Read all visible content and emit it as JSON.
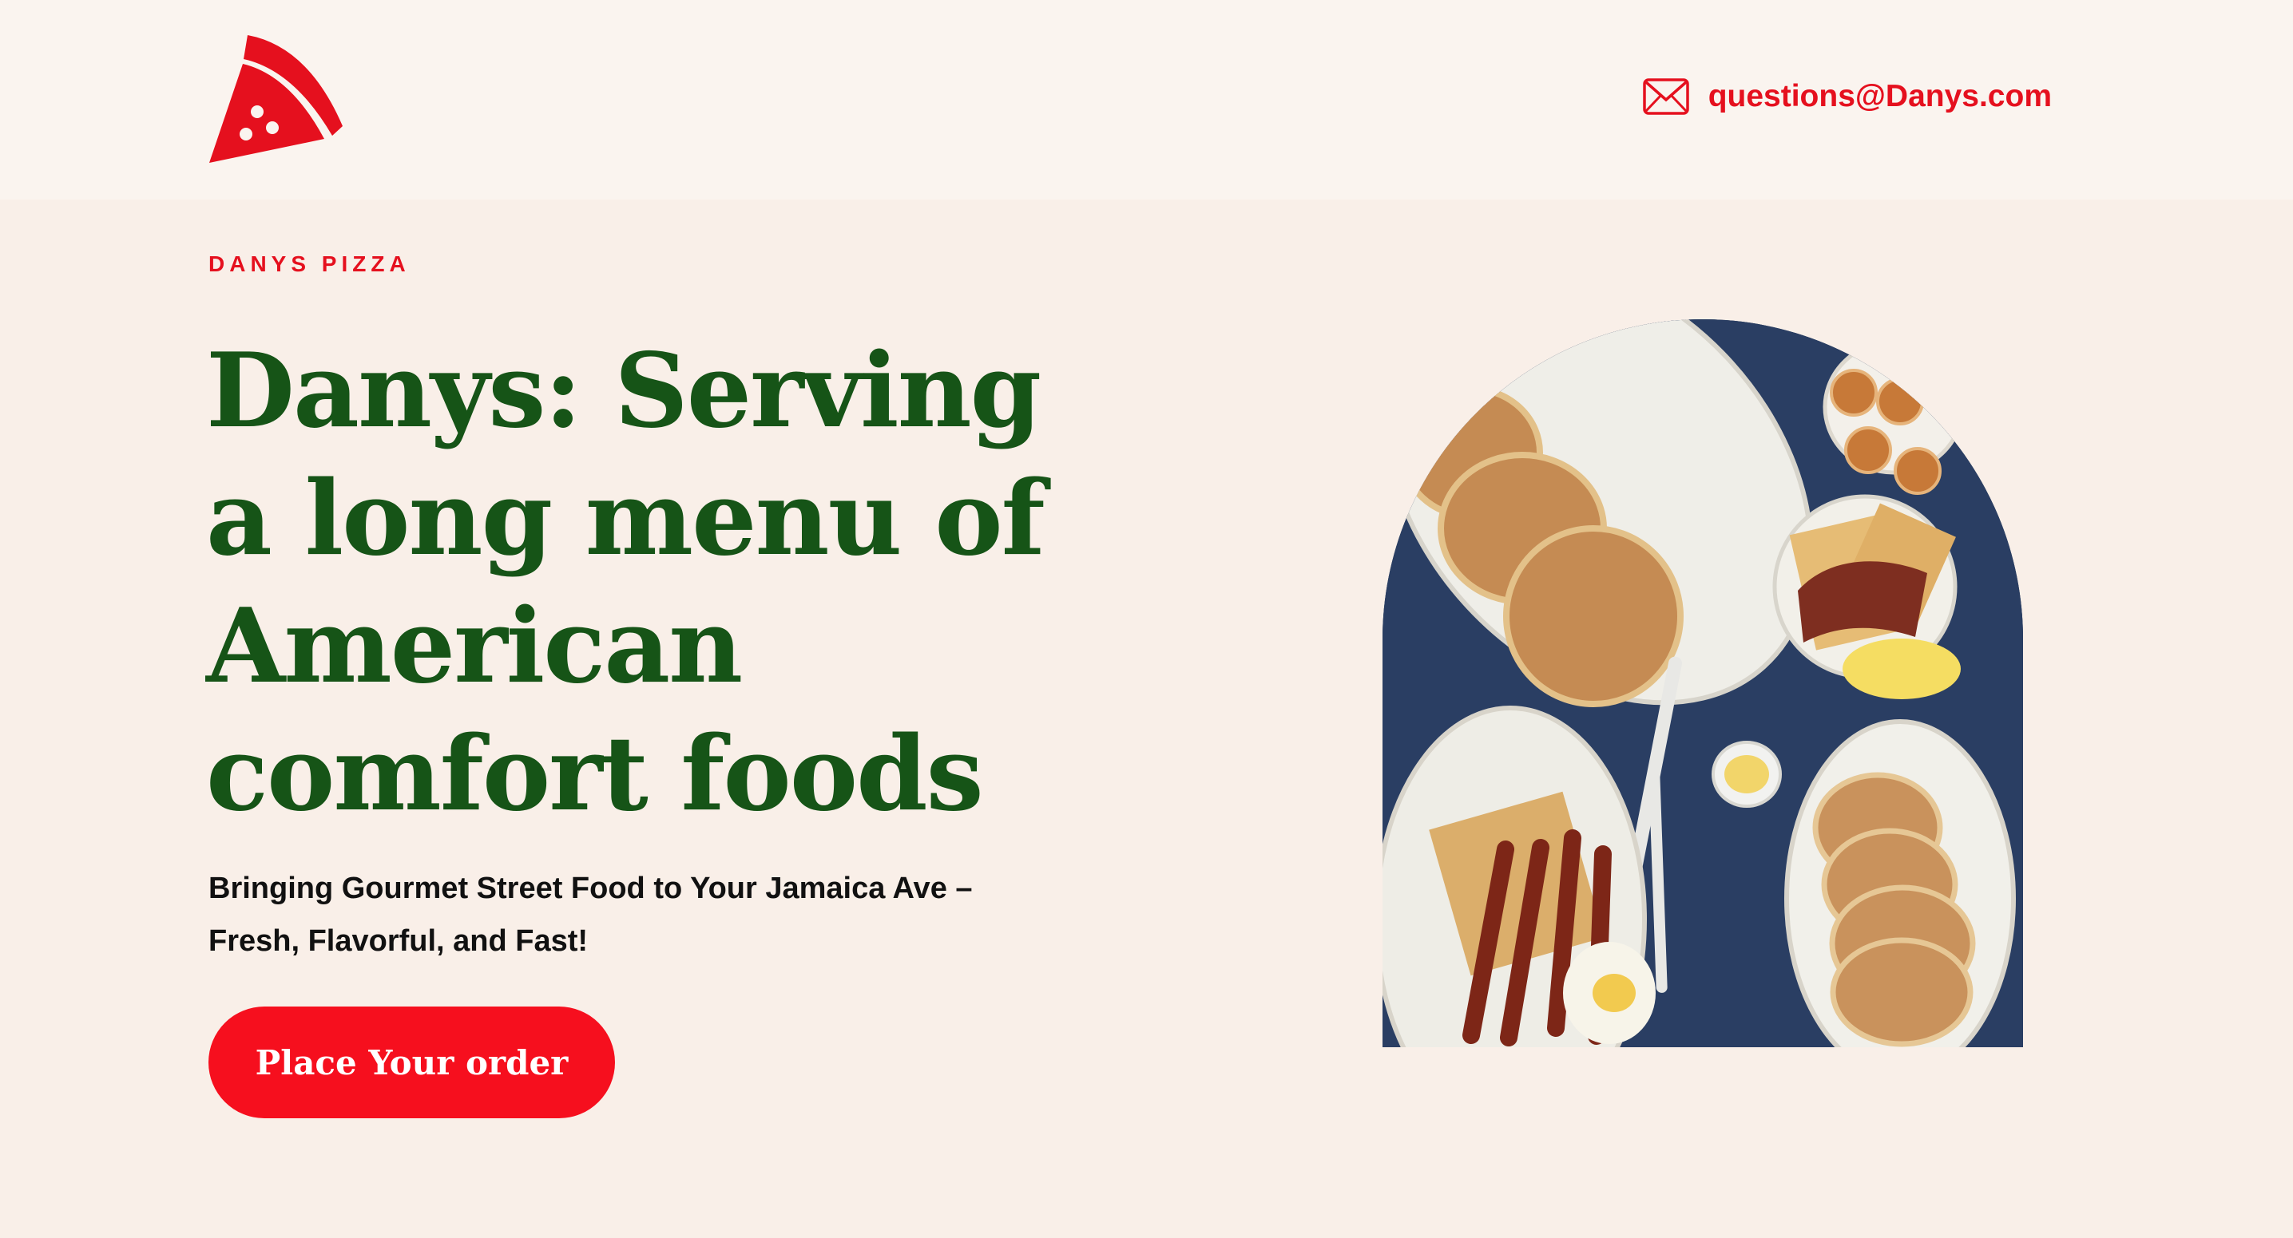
{
  "corner_button": {
    "icon": "arrow-down-right-icon"
  },
  "header": {
    "logo_icon": "pizza-slice-icon",
    "contact": {
      "icon": "envelope-icon",
      "email": "questions@Danys.com"
    }
  },
  "hero": {
    "eyebrow": "DANYS PIZZA",
    "headline": "Danys: Serving a long menu of American comfort foods",
    "subheading": "Bringing Gourmet Street Food to Your Jamaica Ave – Fresh, Flavorful, and Fast!",
    "cta_label": "Place Your order",
    "image": "breakfast-plates-photo"
  },
  "colors": {
    "accent_red": "#e5101e",
    "cta_red": "#f60f1e",
    "headline_green": "#165417",
    "header_bg": "#faf4ef",
    "hero_bg": "#f9efe8"
  }
}
